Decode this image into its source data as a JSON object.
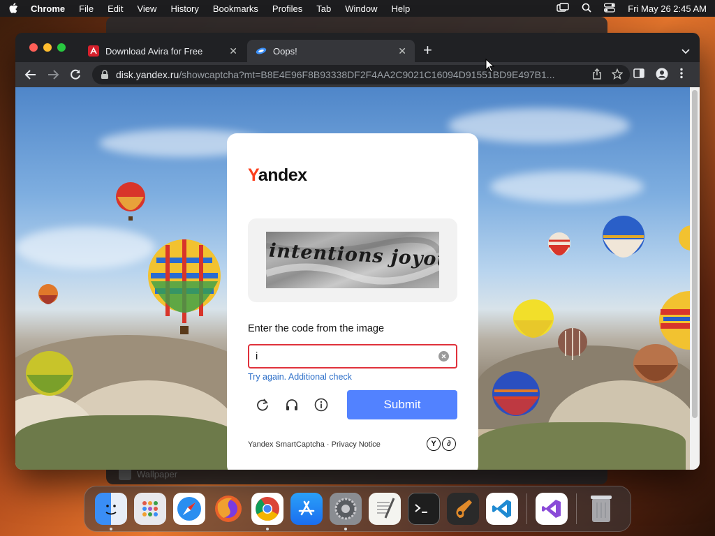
{
  "menubar": {
    "app_name": "Chrome",
    "menus": [
      "File",
      "Edit",
      "View",
      "History",
      "Bookmarks",
      "Profiles",
      "Tab",
      "Window",
      "Help"
    ],
    "clock": "Fri May 26  2:45 AM"
  },
  "background_window": {
    "label": "Wallpaper"
  },
  "browser": {
    "tabs": [
      {
        "title": "Download Avira for Free",
        "favicon": "avira-icon",
        "active": false
      },
      {
        "title": "Oops!",
        "favicon": "yandex-disk-icon",
        "active": true
      }
    ],
    "url": {
      "host": "disk.yandex.ru",
      "path": "/showcaptcha?mt=B8E4E96F8B93338DF2F4AA2C9021C16094D91551BD9E497B1..."
    }
  },
  "captcha": {
    "logo_y": "Y",
    "logo_rest": "andex",
    "image_text": "intentions joyous",
    "prompt": "Enter the code from the image",
    "input_value": "i",
    "error": "Try again. Additional check",
    "submit_label": "Submit",
    "footer": "Yandex SmartCaptcha · Privacy Notice",
    "footer_logo_1": "Y",
    "footer_logo_2": "∂",
    "accent_color": "#5282ff",
    "error_color": "#e0313b"
  },
  "dock": {
    "apps": [
      "finder-icon",
      "launchpad-icon",
      "safari-icon",
      "firefox-icon",
      "chrome-icon",
      "app-store-icon",
      "system-preferences-icon",
      "textedit-icon",
      "terminal-icon",
      "garageband-icon",
      "vscode-icon",
      "visual-studio-icon",
      "trash-icon"
    ]
  }
}
